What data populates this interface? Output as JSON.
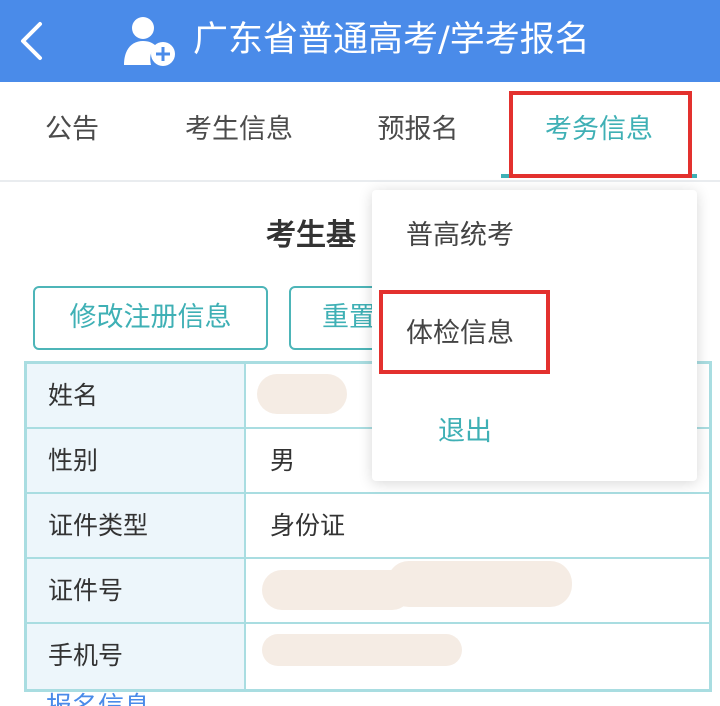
{
  "header": {
    "title": "广东省普通高考/学考报名",
    "background_color": "#4a8be9",
    "back_icon": "chevron-left-icon",
    "user_icon": "user-add-icon"
  },
  "tabs": [
    {
      "label": "公告",
      "active": false
    },
    {
      "label": "考生信息",
      "active": false
    },
    {
      "label": "预报名",
      "active": false
    },
    {
      "label": "考务信息",
      "active": true
    }
  ],
  "accent_color": "#3fb0b5",
  "highlight_color": "#e3312e",
  "section": {
    "title": "考生基"
  },
  "buttons": {
    "edit_label": "修改注册信息",
    "reset_label": "重置"
  },
  "info_table": {
    "rows": [
      {
        "label": "姓名",
        "value": ""
      },
      {
        "label": "性别",
        "value": "男"
      },
      {
        "label": "证件类型",
        "value": "身份证"
      },
      {
        "label": "证件号",
        "value": ""
      },
      {
        "label": "手机号",
        "value": ""
      }
    ]
  },
  "bottom_link": "报名信息",
  "dropdown": {
    "items": [
      {
        "label": "普高统考"
      },
      {
        "label": "体检信息"
      },
      {
        "label": "退出"
      }
    ]
  }
}
